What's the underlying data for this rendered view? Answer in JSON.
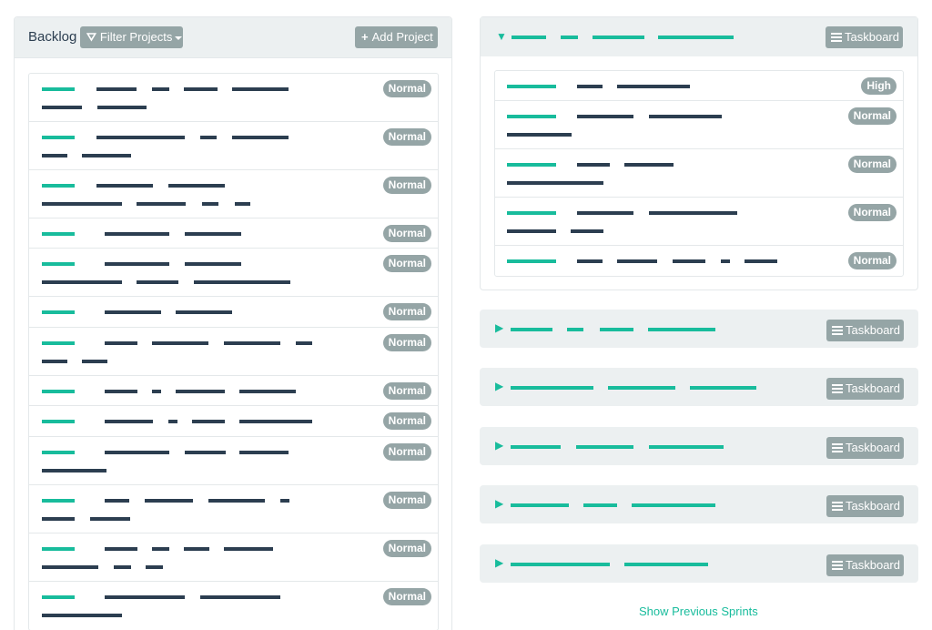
{
  "backlog": {
    "title": "Backlog",
    "filter_label": "Filter Projects",
    "add_label": "Add Project",
    "rows": [
      {
        "priority": "Normal",
        "h": 53
      },
      {
        "priority": "Normal",
        "h": 53
      },
      {
        "priority": "Normal",
        "h": 53
      },
      {
        "priority": "Normal",
        "h": 33
      },
      {
        "priority": "Normal",
        "h": 53
      },
      {
        "priority": "Normal",
        "h": 34
      },
      {
        "priority": "Normal",
        "h": 53
      },
      {
        "priority": "Normal",
        "h": 33
      },
      {
        "priority": "Normal",
        "h": 34
      },
      {
        "priority": "Normal",
        "h": 53
      },
      {
        "priority": "Normal",
        "h": 53
      },
      {
        "priority": "Normal",
        "h": 53
      },
      {
        "priority": "Normal",
        "h": 53
      }
    ]
  },
  "sprints": {
    "taskboard_label": "Taskboard",
    "open_toggle": "▼",
    "closed_toggle": "▶",
    "open_rows": [
      {
        "priority": "High"
      },
      {
        "priority": "Normal"
      },
      {
        "priority": "Normal"
      },
      {
        "priority": "Normal"
      },
      {
        "priority": "Normal"
      }
    ]
  },
  "show_previous_label": "Show Previous Sprints",
  "colors": {
    "teal": "#18bc9c",
    "navy": "#2c3e50",
    "badge": "#95a5a6",
    "header": "#ecf0f1"
  }
}
